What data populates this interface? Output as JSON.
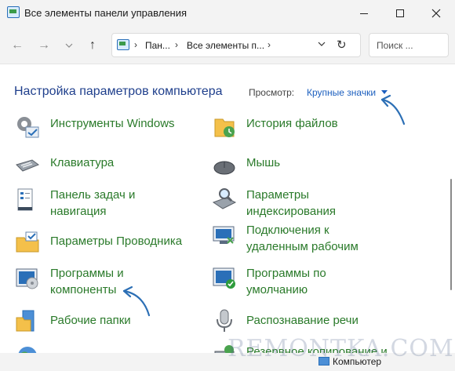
{
  "window": {
    "title": "Все элементы панели управления",
    "minimize_icon": "minimize-icon",
    "maximize_icon": "maximize-icon",
    "close_icon": "close-icon"
  },
  "nav": {
    "back_icon": "←",
    "forward_icon": "→",
    "history_icon": "⌄",
    "up_icon": "↑",
    "breadcrumbs": [
      "Пан...",
      "Все элементы п..."
    ],
    "refresh_icon": "↻",
    "search_placeholder": "Поиск ..."
  },
  "header": {
    "title": "Настройка параметров компьютера",
    "view_label": "Просмотр:",
    "view_value": "Крупные значки"
  },
  "items_left": [
    {
      "label": "Инструменты Windows",
      "icon": "tools-icon"
    },
    {
      "label": "Клавиатура",
      "icon": "keyboard-icon"
    },
    {
      "label": "Панель задач и\nнавигация",
      "icon": "taskbar-icon"
    },
    {
      "label": "Параметры Проводника",
      "icon": "explorer-options-icon"
    },
    {
      "label": "Программы и\nкомпоненты",
      "icon": "programs-icon"
    },
    {
      "label": "Рабочие папки",
      "icon": "work-folders-icon"
    },
    {
      "label": "",
      "icon": "region-icon"
    }
  ],
  "items_right": [
    {
      "label": "История файлов",
      "icon": "file-history-icon"
    },
    {
      "label": "Мышь",
      "icon": "mouse-icon"
    },
    {
      "label": "Параметры\nиндексирования",
      "icon": "indexing-icon"
    },
    {
      "label": "Подключения к\nудаленным рабочим",
      "icon": "remote-desktop-icon"
    },
    {
      "label": "Программы по\nумолчанию",
      "icon": "default-programs-icon"
    },
    {
      "label": "Распознавание речи",
      "icon": "speech-icon"
    },
    {
      "label": "Резервное копирование и",
      "icon": "backup-icon"
    }
  ],
  "status": {
    "computer": "Компьютер"
  },
  "watermark": "REMONTKA.COM",
  "colors": {
    "link_green": "#2a7a2a",
    "heading_blue": "#1f3f8c",
    "accent_blue": "#1c5fbf"
  }
}
